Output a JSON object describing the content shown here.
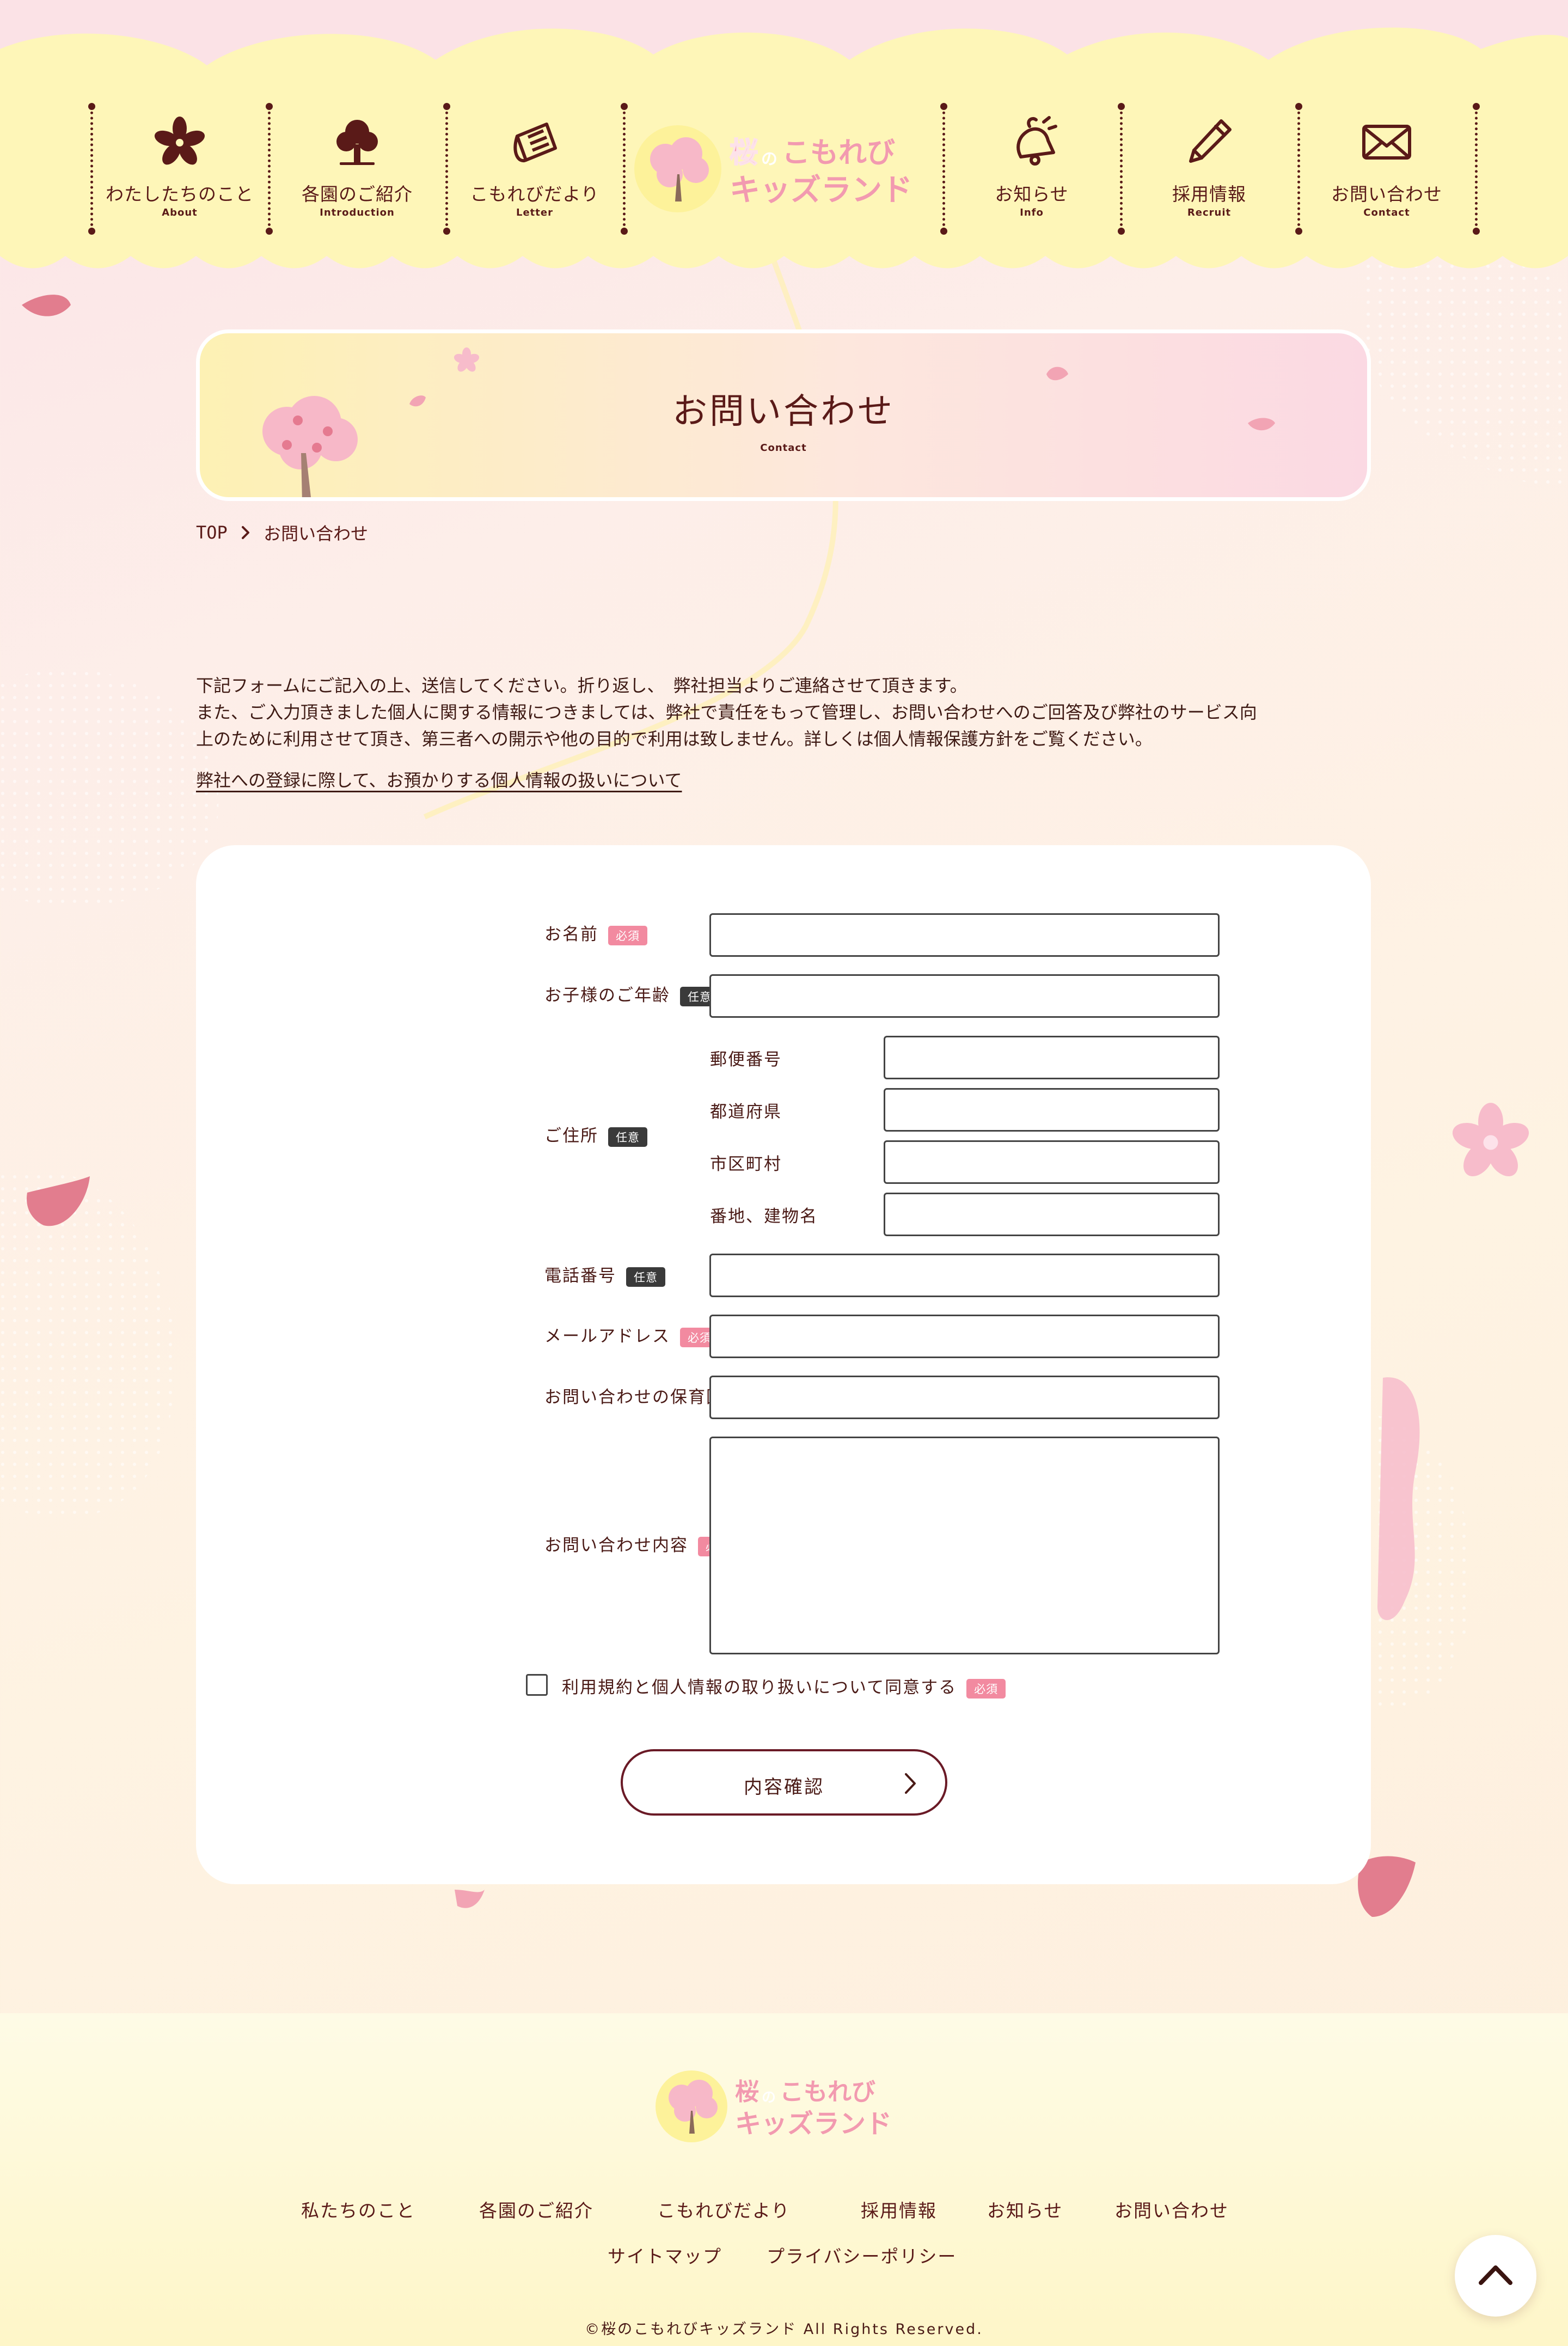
{
  "site": {
    "logo_line1_a": "桜",
    "logo_line1_b": "の",
    "logo_line1_c": "こもれび",
    "logo_line2": "キッズランド"
  },
  "nav": [
    {
      "ja": "わたしたちのこと",
      "en": "About",
      "icon": "sakura-flower-icon"
    },
    {
      "ja": "各園のご紹介",
      "en": "Introduction",
      "icon": "tree-icon"
    },
    {
      "ja": "こもれびだより",
      "en": "Letter",
      "icon": "newspaper-icon"
    },
    {
      "ja": "お知らせ",
      "en": "Info",
      "icon": "bell-icon"
    },
    {
      "ja": "採用情報",
      "en": "Recruit",
      "icon": "pen-icon"
    },
    {
      "ja": "お問い合わせ",
      "en": "Contact",
      "icon": "mail-icon"
    }
  ],
  "page": {
    "title": "お問い合わせ",
    "title_en": "Contact"
  },
  "breadcrumb": {
    "home": "TOP",
    "current": "お問い合わせ"
  },
  "intro": {
    "line1": "下記フォームにご記入の上、送信してください。折り返し、　弊社担当よりご連絡させて頂きます。",
    "line2": "また、ご入力頂きました個人に関する情報につきましては、弊社で責任をもって管理し、お問い合わせへのご回答及び弊社のサービス向",
    "line3": "上のために利用させて頂き、第三者への開示や他の目的で利用は致しません。詳しくは個人情報保護方針をご覧ください。",
    "privacy_link": "弊社への登録に際して、お預かりする個人情報の扱いについて"
  },
  "form": {
    "required_label": "必須",
    "optional_label": "任意",
    "name": {
      "label": "お名前",
      "value": ""
    },
    "child_age": {
      "label": "お子様のご年齢",
      "value": ""
    },
    "address": {
      "label": "ご住所",
      "postal": {
        "label": "郵便番号",
        "value": ""
      },
      "prefecture": {
        "label": "都道府県",
        "value": ""
      },
      "city": {
        "label": "市区町村",
        "value": ""
      },
      "street": {
        "label": "番地、建物名",
        "value": ""
      }
    },
    "phone": {
      "label": "電話番号",
      "value": ""
    },
    "email": {
      "label": "メールアドレス",
      "value": ""
    },
    "nursery": {
      "label": "お問い合わせの保育園",
      "value": ""
    },
    "message": {
      "label": "お問い合わせ内容",
      "value": ""
    },
    "agree": {
      "label": "利用規約と個人情報の取り扱いについて同意する",
      "checked": false
    },
    "submit": "内容確認"
  },
  "footer": {
    "nav": [
      "私たちのこと",
      "各園のご紹介",
      "こもれびだより",
      "採用情報",
      "お知らせ",
      "お問い合わせ"
    ],
    "nav2": [
      "サイトマップ",
      "プライバシーポリシー"
    ],
    "copyright": "©桜のこもれびキッズランド All Rights Reserved."
  },
  "colors": {
    "primary_text": "#5a1a18",
    "required_badge": "#f28aa0",
    "optional_badge": "#3a3a3a",
    "header_yellow": "#fdf6b8",
    "sakura_pink": "#f6b6c6"
  }
}
